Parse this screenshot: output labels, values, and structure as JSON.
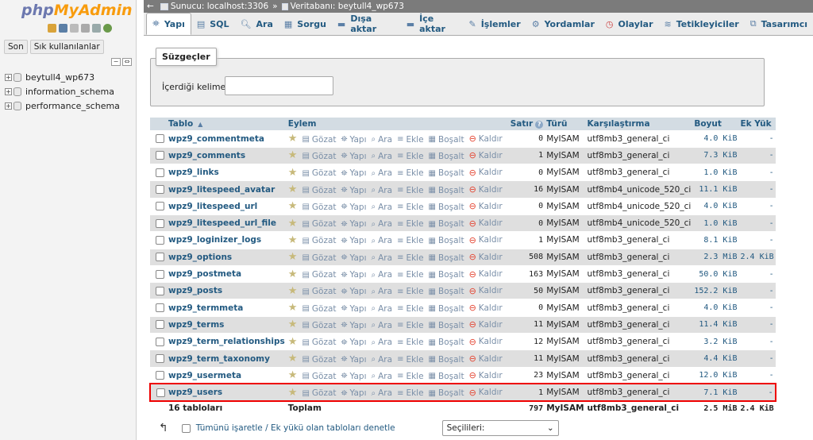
{
  "nav": {
    "logo_php": "php",
    "logo_myadmin": "MyAdmin",
    "recent_button": "Son",
    "favorites_button": "Sık kullanılanlar",
    "databases": [
      "beytull4_wp673",
      "information_schema",
      "performance_schema"
    ]
  },
  "breadcrumb": {
    "server_label": "Sunucu: localhost:3306",
    "separator": "»",
    "database_label": "Veritabanı: beytull4_wp673"
  },
  "tabs": [
    {
      "label": "Yapı",
      "icon": "structure-icon",
      "active": true
    },
    {
      "label": "SQL",
      "icon": "sql-icon"
    },
    {
      "label": "Ara",
      "icon": "search-icon"
    },
    {
      "label": "Sorgu",
      "icon": "query-icon"
    },
    {
      "label": "Dışa aktar",
      "icon": "export-icon"
    },
    {
      "label": "İçe aktar",
      "icon": "import-icon"
    },
    {
      "label": "İşlemler",
      "icon": "wrench-icon"
    },
    {
      "label": "Yordamlar",
      "icon": "routines-icon"
    },
    {
      "label": "Olaylar",
      "icon": "clock-icon"
    },
    {
      "label": "Tetikleyiciler",
      "icon": "triggers-icon"
    },
    {
      "label": "Tasarımcı",
      "icon": "designer-icon"
    }
  ],
  "filters": {
    "legend": "Süzgeçler",
    "keyword_label": "İçerdiği kelime:",
    "keyword_value": ""
  },
  "table": {
    "headers": {
      "table": "Tablo",
      "action": "Eylem",
      "rows": "Satır",
      "type": "Türü",
      "collation": "Karşılaştırma",
      "size": "Boyut",
      "overhead": "Ek Yük"
    },
    "actions": {
      "browse": "Gözat",
      "structure": "Yapı",
      "search": "Ara",
      "insert": "Ekle",
      "empty": "Boşalt",
      "drop": "Kaldır"
    },
    "rows": [
      {
        "name": "wpz9_commentmeta",
        "rows": "0",
        "type": "MyISAM",
        "collation": "utf8mb3_general_ci",
        "size": "4.0 KiB",
        "overhead": "-"
      },
      {
        "name": "wpz9_comments",
        "rows": "1",
        "type": "MyISAM",
        "collation": "utf8mb3_general_ci",
        "size": "7.3 KiB",
        "overhead": "-"
      },
      {
        "name": "wpz9_links",
        "rows": "0",
        "type": "MyISAM",
        "collation": "utf8mb3_general_ci",
        "size": "1.0 KiB",
        "overhead": "-"
      },
      {
        "name": "wpz9_litespeed_avatar",
        "rows": "16",
        "type": "MyISAM",
        "collation": "utf8mb4_unicode_520_ci",
        "size": "11.1 KiB",
        "overhead": "-"
      },
      {
        "name": "wpz9_litespeed_url",
        "rows": "0",
        "type": "MyISAM",
        "collation": "utf8mb4_unicode_520_ci",
        "size": "4.0 KiB",
        "overhead": "-"
      },
      {
        "name": "wpz9_litespeed_url_file",
        "rows": "0",
        "type": "MyISAM",
        "collation": "utf8mb4_unicode_520_ci",
        "size": "1.0 KiB",
        "overhead": "-"
      },
      {
        "name": "wpz9_loginizer_logs",
        "rows": "1",
        "type": "MyISAM",
        "collation": "utf8mb3_general_ci",
        "size": "8.1 KiB",
        "overhead": "-"
      },
      {
        "name": "wpz9_options",
        "rows": "508",
        "type": "MyISAM",
        "collation": "utf8mb3_general_ci",
        "size": "2.3 MiB",
        "overhead": "2.4 KiB"
      },
      {
        "name": "wpz9_postmeta",
        "rows": "163",
        "type": "MyISAM",
        "collation": "utf8mb3_general_ci",
        "size": "50.0 KiB",
        "overhead": "-"
      },
      {
        "name": "wpz9_posts",
        "rows": "50",
        "type": "MyISAM",
        "collation": "utf8mb3_general_ci",
        "size": "152.2 KiB",
        "overhead": "-"
      },
      {
        "name": "wpz9_termmeta",
        "rows": "0",
        "type": "MyISAM",
        "collation": "utf8mb3_general_ci",
        "size": "4.0 KiB",
        "overhead": "-"
      },
      {
        "name": "wpz9_terms",
        "rows": "11",
        "type": "MyISAM",
        "collation": "utf8mb3_general_ci",
        "size": "11.4 KiB",
        "overhead": "-"
      },
      {
        "name": "wpz9_term_relationships",
        "rows": "12",
        "type": "MyISAM",
        "collation": "utf8mb3_general_ci",
        "size": "3.2 KiB",
        "overhead": "-"
      },
      {
        "name": "wpz9_term_taxonomy",
        "rows": "11",
        "type": "MyISAM",
        "collation": "utf8mb3_general_ci",
        "size": "4.4 KiB",
        "overhead": "-"
      },
      {
        "name": "wpz9_usermeta",
        "rows": "23",
        "type": "MyISAM",
        "collation": "utf8mb3_general_ci",
        "size": "12.0 KiB",
        "overhead": "-"
      },
      {
        "name": "wpz9_users",
        "rows": "1",
        "type": "MyISAM",
        "collation": "utf8mb3_general_ci",
        "size": "7.1 KiB",
        "overhead": "-",
        "highlighted": true
      }
    ],
    "footer": {
      "count": "16 tabloları",
      "label": "Toplam",
      "rows": "797",
      "type": "MyISAM",
      "collation": "utf8mb3_general_ci",
      "size": "2.5 MiB",
      "overhead": "2.4 KiB"
    }
  },
  "bottom": {
    "check_all_label": "Tümünü işaretle / Ek yükü olan tabloları denetle",
    "with_selected": "Seçilileri:"
  },
  "colors": {
    "link": "#235a81",
    "header_bg": "#d3dce3",
    "highlight_border": "#e00000",
    "logo_php": "#6c78af",
    "logo_admin": "#f89c0e"
  }
}
